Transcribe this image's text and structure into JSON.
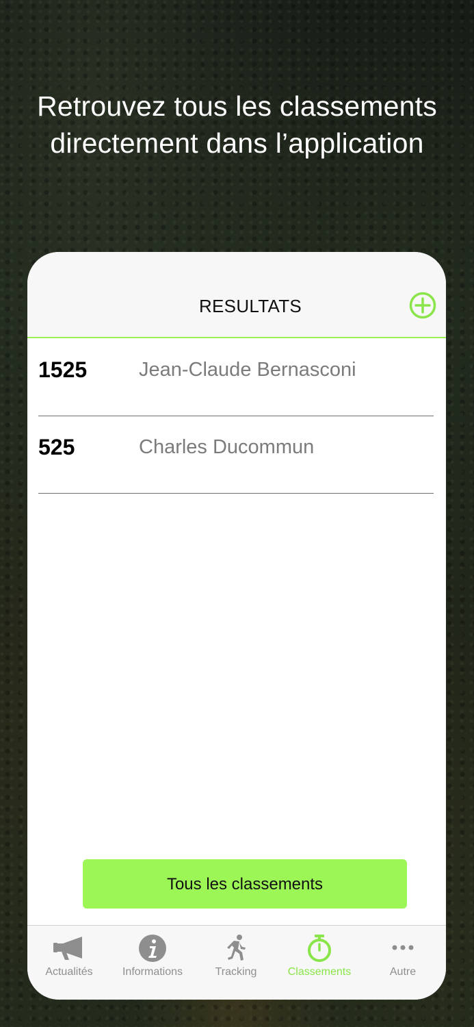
{
  "headline": {
    "line1": "Retrouvez tous les classements",
    "line2": "directement dans l’application"
  },
  "navbar": {
    "title": "RESULTATS",
    "add_icon": "plus-circle-icon"
  },
  "results": [
    {
      "number": "1525",
      "name": "Jean-Claude Bernasconi"
    },
    {
      "number": "525",
      "name": "Charles Ducommun"
    }
  ],
  "cta": {
    "label": "Tous les classements"
  },
  "tabbar": {
    "items": [
      {
        "label": "Actualités",
        "icon": "megaphone-icon",
        "active": false
      },
      {
        "label": "Informations",
        "icon": "info-icon",
        "active": false
      },
      {
        "label": "Tracking",
        "icon": "runner-icon",
        "active": false
      },
      {
        "label": "Classements",
        "icon": "stopwatch-icon",
        "active": true
      },
      {
        "label": "Autre",
        "icon": "more-icon",
        "active": false
      }
    ]
  },
  "colors": {
    "accent": "#9cf655",
    "accent_text": "#8ae54a",
    "inactive": "#8e8e8e"
  }
}
